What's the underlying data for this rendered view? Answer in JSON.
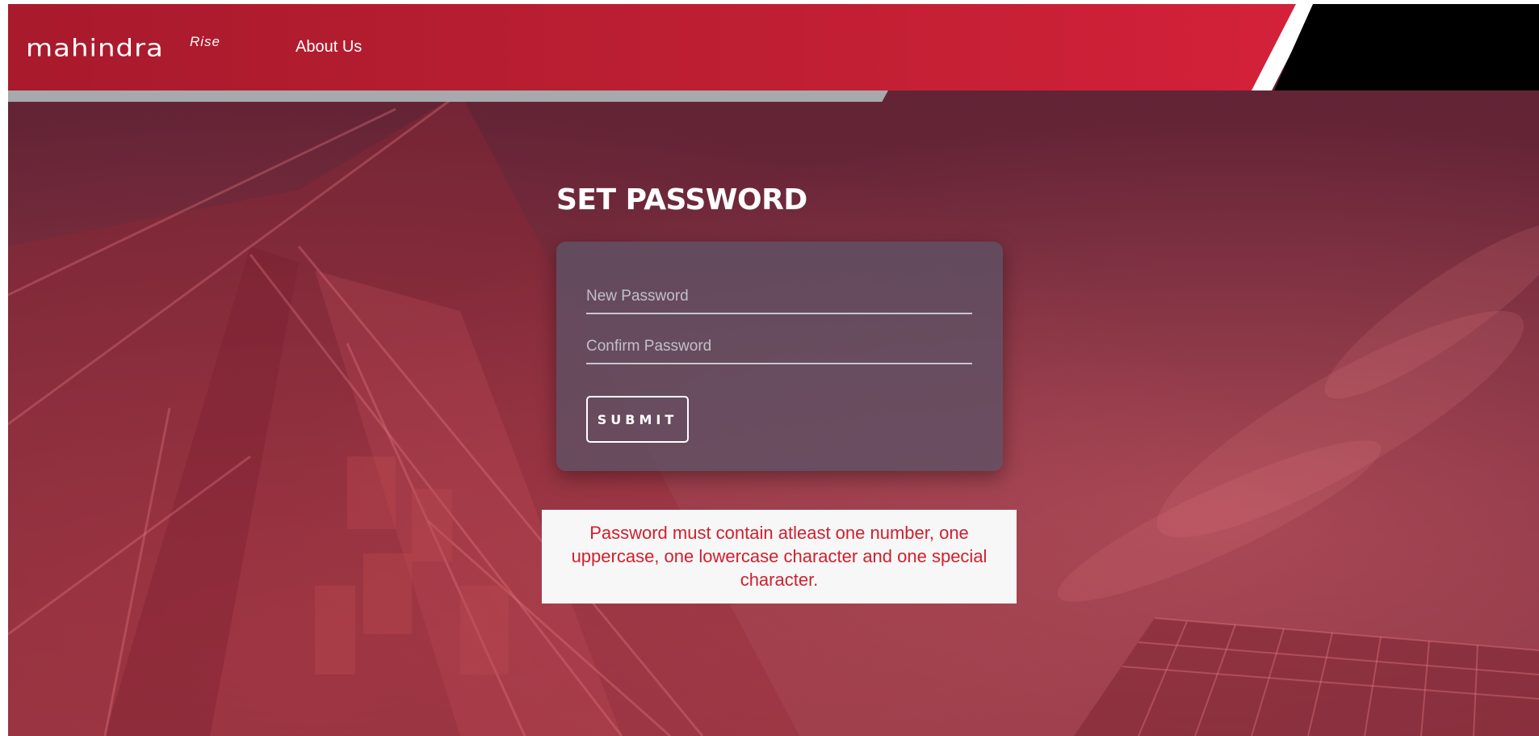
{
  "header": {
    "logo_text": "mahindra",
    "logo_superscript": "Rise",
    "nav_about": "About Us"
  },
  "main": {
    "title": "SET PASSWORD",
    "new_password_placeholder": "New Password",
    "confirm_password_placeholder": "Confirm Password",
    "submit_label": "SUBMIT",
    "error_message": "Password must contain atleast one number, one uppercase, one lowercase character and one special character."
  },
  "colors": {
    "header_red": "#c01f33",
    "error_red": "#d0202e",
    "gray_bar": "#a7a9ac"
  }
}
